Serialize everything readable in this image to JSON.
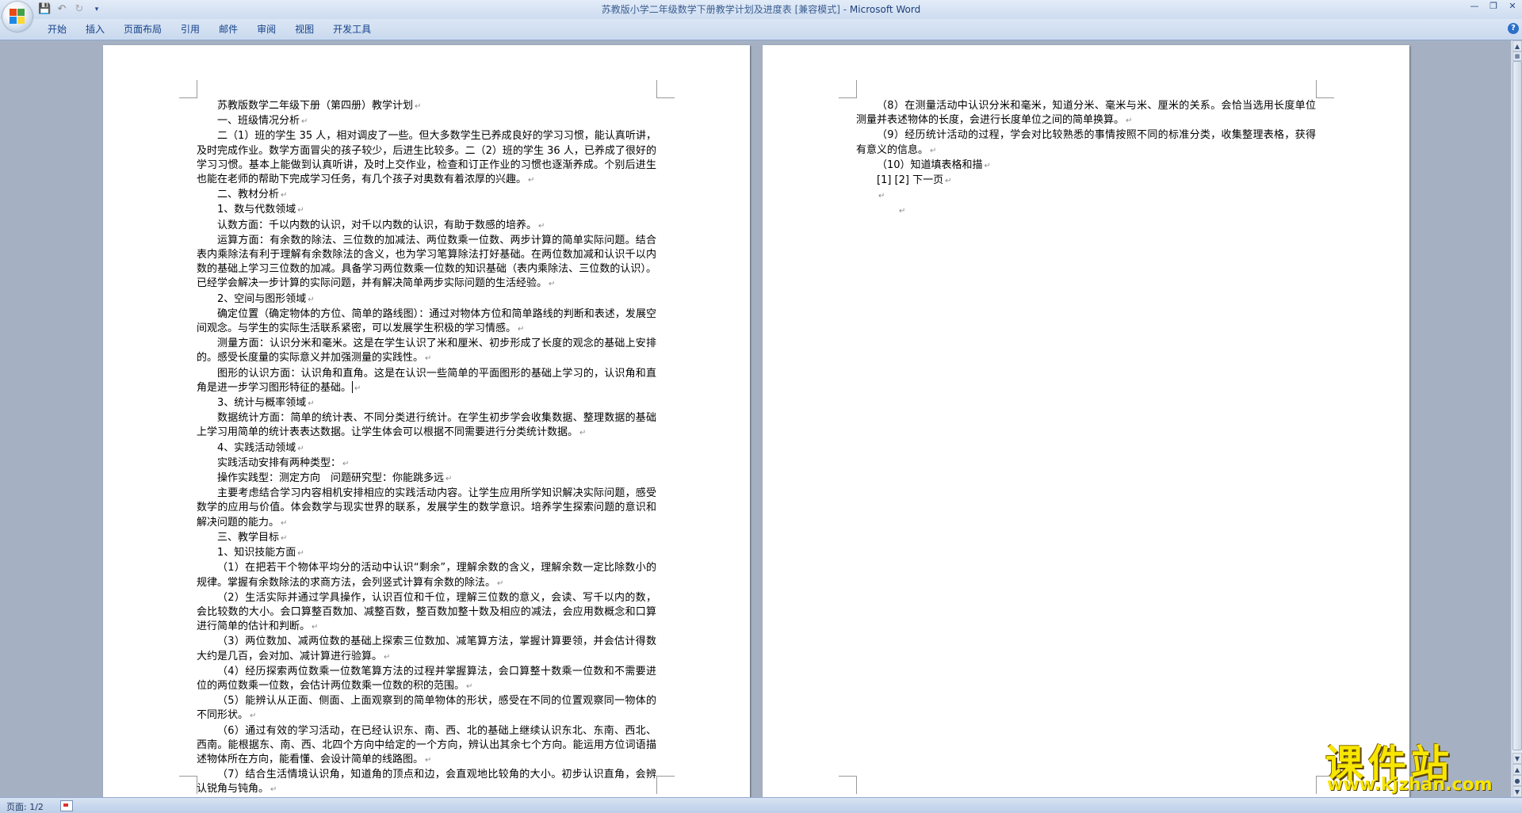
{
  "window": {
    "title": "苏教版小学二年级数学下册教学计划及进度表 [兼容模式] - ",
    "app_name": "Microsoft Word"
  },
  "quick_access": [
    "save-icon",
    "undo-icon",
    "redo-icon",
    "customize-icon"
  ],
  "ribbon": {
    "tabs": [
      "开始",
      "插入",
      "页面布局",
      "引用",
      "邮件",
      "审阅",
      "视图",
      "开发工具"
    ]
  },
  "page1": {
    "paragraphs": [
      "苏教版数学二年级下册（第四册）教学计划",
      "一、班级情况分析",
      "二（1）班的学生 35 人，相对调皮了一些。但大多数学生已养成良好的学习习惯，能认真听讲，及时完成作业。数学方面冒尖的孩子较少，后进生比较多。二（2）班的学生 36 人，已养成了很好的学习习惯。基本上能做到认真听讲，及时上交作业，检查和订正作业的习惯也逐渐养成。个别后进生也能在老师的帮助下完成学习任务，有几个孩子对奥数有着浓厚的兴趣。",
      "二、教材分析",
      "1、数与代数领域",
      "认数方面：千以内数的认识，对千以内数的认识，有助于数感的培养。",
      "运算方面：有余数的除法、三位数的加减法、两位数乘一位数、两步计算的简单实际问题。结合表内乘除法有利于理解有余数除法的含义，也为学习笔算除法打好基础。在两位数加减和认识千以内数的基础上学习三位数的加减。具备学习两位数乘一位数的知识基础（表内乘除法、三位数的认识）。已经学会解决一步计算的实际问题，并有解决简单两步实际问题的生活经验。",
      "2、空间与图形领域",
      "确定位置（确定物体的方位、简单的路线图）：通过对物体方位和简单路线的判断和表述，发展空间观念。与学生的实际生活联系紧密，可以发展学生积极的学习情感。",
      "测量方面：认识分米和毫米。这是在学生认识了米和厘米、初步形成了长度的观念的基础上安排的。感受长度量的实际意义并加强测量的实践性。",
      "图形的认识方面：认识角和直角。这是在认识一些简单的平面图形的基础上学习的，认识角和直角是进一步学习图形特征的基础。",
      "3、统计与概率领域",
      "数据统计方面：简单的统计表、不同分类进行统计。在学生初步学会收集数据、整理数据的基础上学习用简单的统计表表达数据。让学生体会可以根据不同需要进行分类统计数据。",
      "4、实践活动领域",
      "实践活动安排有两种类型：",
      "操作实践型：测定方向　问题研究型：你能跳多远",
      "主要考虑结合学习内容相机安排相应的实践活动内容。让学生应用所学知识解决实际问题，感受数学的应用与价值。体会数学与现实世界的联系，发展学生的数学意识。培养学生探索问题的意识和解决问题的能力。",
      "三、教学目标",
      "1、知识技能方面",
      "（1）在把若干个物体平均分的活动中认识“剩余”，理解余数的含义，理解余数一定比除数小的规律。掌握有余数除法的求商方法，会列竖式计算有余数的除法。",
      "（2）生活实际并通过学具操作，认识百位和千位，理解三位数的意义，会读、写千以内的数，会比较数的大小。会口算整百数加、减整百数，整百数加整十数及相应的减法，会应用数概念和口算进行简单的估计和判断。",
      "（3）两位数加、减两位数的基础上探索三位数加、减笔算方法，掌握计算要领，并会估计得数大约是几百，会对加、减计算进行验算。",
      "（4）经历探索两位数乘一位数笔算方法的过程并掌握算法，会口算整十数乘一位数和不需要进位的两位数乘一位数，会估计两位数乘一位数的积的范围。",
      "（5）能辨认从正面、侧面、上面观察到的简单物体的形状，感受在不同的位置观察同一物体的不同形状。",
      "（6）通过有效的学习活动，在已经认识东、南、西、北的基础上继续认识东北、东南、西北、西南。能根据东、南、西、北四个方向中给定的一个方向，辨认出其余七个方向。能运用方位词语描述物体所在方向，能看懂、会设计简单的线路图。",
      "（7）结合生活情境认识角，知道角的顶点和边，会直观地比较角的大小。初步认识直角，会辨认锐角与钝角。"
    ]
  },
  "page2": {
    "paragraphs": [
      "（8）在测量活动中认识分米和毫米，知道分米、毫米与米、厘米的关系。会恰当选用长度单位测量并表述物体的长度，会进行长度单位之间的简单换算。",
      "（9）经历统计活动的过程，学会对比较熟悉的事情按照不同的标准分类，收集整理表格，获得有意义的信息。",
      "（10）知道填表格和描",
      "[1] [2] 下一页",
      "",
      "　　"
    ]
  },
  "statusbar": {
    "page_count": "页面: 1/2"
  },
  "watermark": {
    "text": "课件站",
    "url": "www.kjzhan.com"
  }
}
